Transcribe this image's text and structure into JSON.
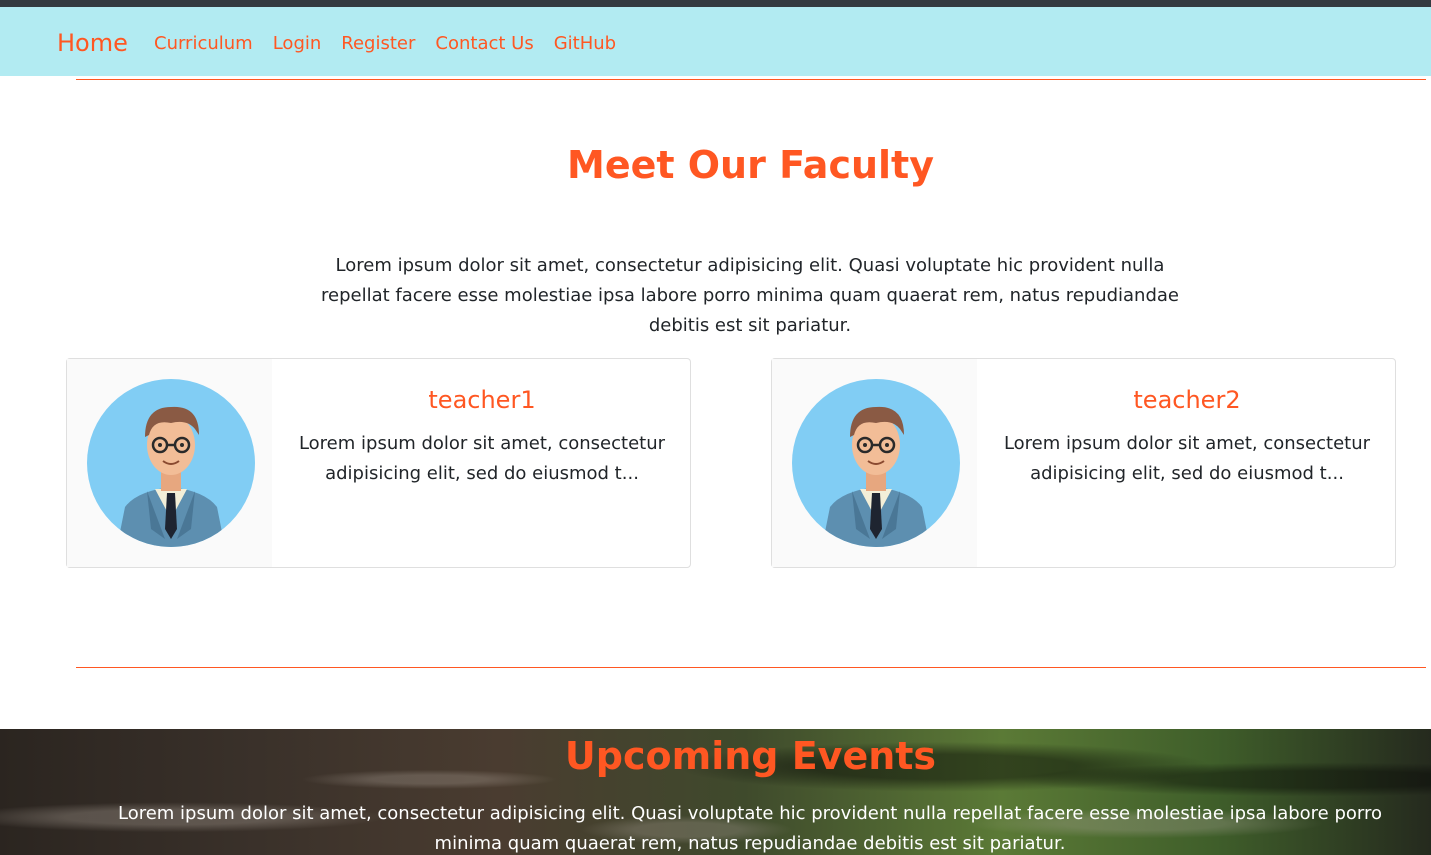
{
  "navbar": {
    "brand": "Home",
    "links": [
      "Curriculum",
      "Login",
      "Register",
      "Contact Us",
      "GitHub"
    ]
  },
  "faculty": {
    "title": "Meet Our Faculty",
    "intro": "Lorem ipsum dolor sit amet, consectetur adipisicing elit. Quasi voluptate hic provident nulla repellat facere esse molestiae ipsa labore porro minima quam quaerat rem, natus repudiandae debitis est sit pariatur.",
    "teachers": [
      {
        "name": "teacher1",
        "text": "Lorem ipsum dolor sit amet, consectetur adipisicing elit, sed do eiusmod t..."
      },
      {
        "name": "teacher2",
        "text": "Lorem ipsum dolor sit amet, consectetur adipisicing elit, sed do eiusmod t..."
      }
    ]
  },
  "events": {
    "title": "Upcoming Events",
    "text": "Lorem ipsum dolor sit amet, consectetur adipisicing elit. Quasi voluptate hic provident nulla repellat facere esse molestiae ipsa labore porro minima quam quaerat rem, natus repudiandae debitis est sit pariatur."
  },
  "colors": {
    "accent": "#ff5722",
    "navbar_bg": "#b2ebf2",
    "topbar": "#343a40",
    "avatar_bg": "#81cdf4"
  },
  "icons": {
    "teacher_avatar": "teacher-avatar-icon"
  }
}
